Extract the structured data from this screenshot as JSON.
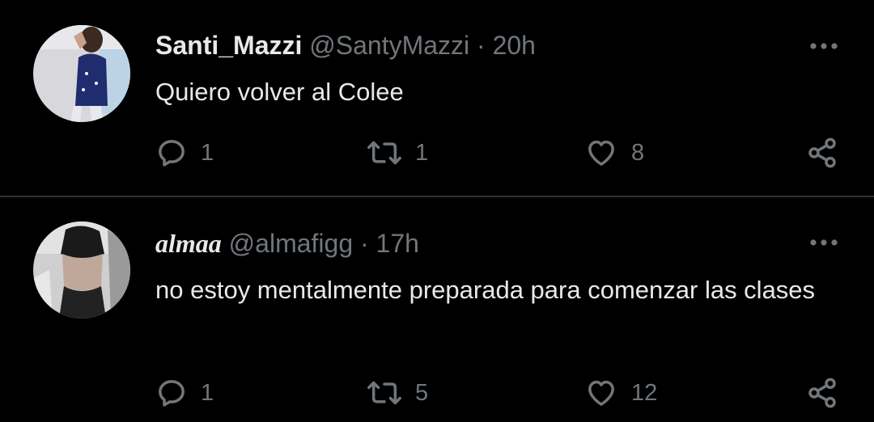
{
  "tweets": [
    {
      "display_name": "Santi_Mazzi",
      "handle": "@SantyMazzi",
      "separator": "·",
      "time": "20h",
      "text": "Quiero volver al Colee",
      "replies": "1",
      "retweets": "1",
      "likes": "8",
      "avatar_icon": "avatar-photo-icon"
    },
    {
      "display_name": "almaa",
      "handle": "@almafigg",
      "separator": "·",
      "time": "17h",
      "text": "no estoy mentalmente preparada para comenzar las clases",
      "replies": "1",
      "retweets": "5",
      "likes": "12",
      "avatar_icon": "avatar-photo-icon"
    }
  ],
  "colors": {
    "background": "#000000",
    "primary_text": "#e7e9ea",
    "secondary_text": "#71767b",
    "divider": "#2f3336"
  }
}
